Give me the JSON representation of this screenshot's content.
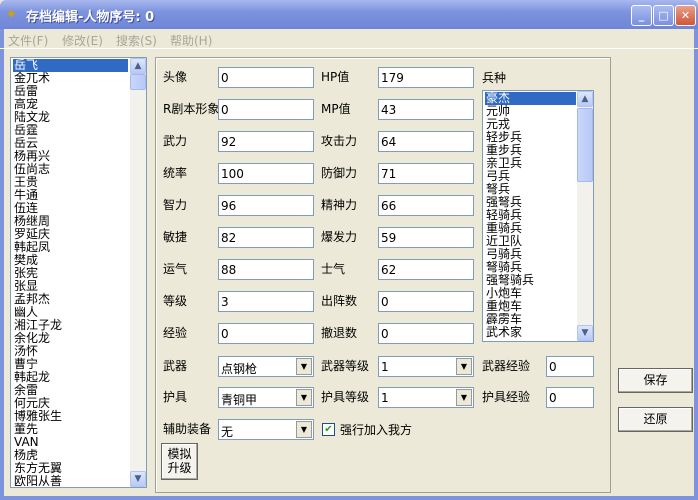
{
  "window": {
    "title": "存档编辑-人物序号: 0",
    "icon": "app-bird-icon",
    "buttons": [
      "minimize",
      "maximize",
      "close"
    ]
  },
  "menu": [
    "文件(F)",
    "修改(E)",
    "搜索(S)",
    "帮助(H)"
  ],
  "characters": {
    "selected": 0,
    "items": [
      "岳飞",
      "金兀术",
      "岳雷",
      "高宠",
      "陆文龙",
      "岳霆",
      "岳云",
      "杨再兴",
      "伍尚志",
      "王贵",
      "牛通",
      "伍连",
      "杨继周",
      "罗延庆",
      "韩起凤",
      "樊成",
      "张宪",
      "张显",
      "孟邦杰",
      "幽人",
      "湘江子龙",
      "余化龙",
      "汤怀",
      "曹宁",
      "韩起龙",
      "余雷",
      "何元庆",
      "博雅张生",
      "董先",
      "VAN",
      "杨虎",
      "东方无翼",
      "欧阳从善"
    ]
  },
  "fields_left": [
    {
      "label": "头像",
      "value": "0"
    },
    {
      "label": "R剧本形象",
      "value": "0"
    },
    {
      "label": "武力",
      "value": "92"
    },
    {
      "label": "统率",
      "value": "100"
    },
    {
      "label": "智力",
      "value": "96"
    },
    {
      "label": "敏捷",
      "value": "82"
    },
    {
      "label": "运气",
      "value": "88"
    },
    {
      "label": "等级",
      "value": "3"
    },
    {
      "label": "经验",
      "value": "0"
    }
  ],
  "fields_right": [
    {
      "label": "HP值",
      "value": "179"
    },
    {
      "label": "MP值",
      "value": "43"
    },
    {
      "label": "攻击力",
      "value": "64"
    },
    {
      "label": "防御力",
      "value": "71"
    },
    {
      "label": "精神力",
      "value": "66"
    },
    {
      "label": "爆发力",
      "value": "59"
    },
    {
      "label": "士气",
      "value": "62"
    },
    {
      "label": "出阵数",
      "value": "0"
    },
    {
      "label": "撤退数",
      "value": "0"
    }
  ],
  "troop": {
    "label": "兵种",
    "selected": 0,
    "items": [
      "豪杰",
      "元帅",
      "元戎",
      "轻步兵",
      "重步兵",
      "亲卫兵",
      "弓兵",
      "弩兵",
      "强弩兵",
      "轻骑兵",
      "重骑兵",
      "近卫队",
      "弓骑兵",
      "弩骑兵",
      "强弩骑兵",
      "小炮车",
      "重炮车",
      "霹雳车",
      "武术家"
    ]
  },
  "equipment": {
    "weapon": {
      "label": "武器",
      "value": "点钢枪",
      "level_label": "武器等级",
      "level": "1",
      "exp_label": "武器经验",
      "exp": "0"
    },
    "armor": {
      "label": "护具",
      "value": "青铜甲",
      "level_label": "护具等级",
      "level": "1",
      "exp_label": "护具经验",
      "exp": "0"
    },
    "accessory": {
      "label": "辅助装备",
      "value": "无"
    },
    "force_join": {
      "label": "强行加入我方",
      "checked": true
    }
  },
  "buttons": {
    "simulate_l1": "模拟",
    "simulate_l2": "升级",
    "save": "保存",
    "restore": "还原"
  }
}
